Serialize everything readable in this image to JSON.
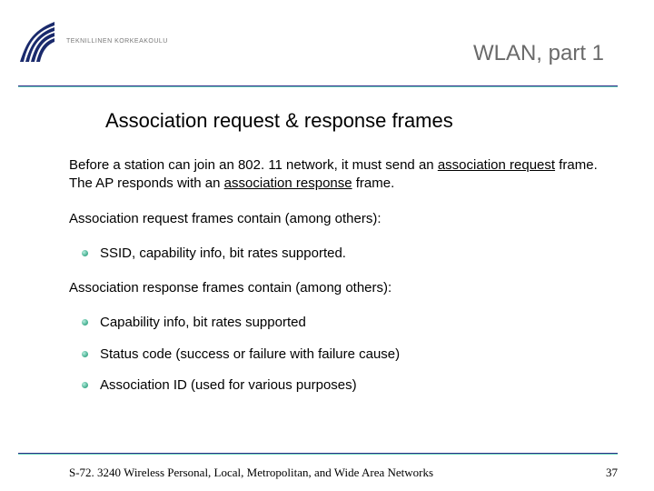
{
  "header": {
    "logo_text": "TEKNILLINEN KORKEAKOULU",
    "title": "WLAN, part 1"
  },
  "slide_title": "Association request & response frames",
  "paragraph1": {
    "pre": "Before a station can join an 802. 11 network, it must send an ",
    "u1": "association request",
    "mid": " frame. The AP responds with an ",
    "u2": "association response",
    "post": " frame."
  },
  "paragraph2": "Association request frames contain (among others):",
  "request_bullets": [
    "SSID, capability info, bit rates supported."
  ],
  "paragraph3": "Association response frames contain (among others):",
  "response_bullets": [
    "Capability info, bit rates supported",
    "Status code (success or failure with failure cause)",
    "Association ID (used for various purposes)"
  ],
  "footer": {
    "course": "S-72. 3240 Wireless Personal, Local, Metropolitan, and Wide Area Networks",
    "page": "37"
  }
}
